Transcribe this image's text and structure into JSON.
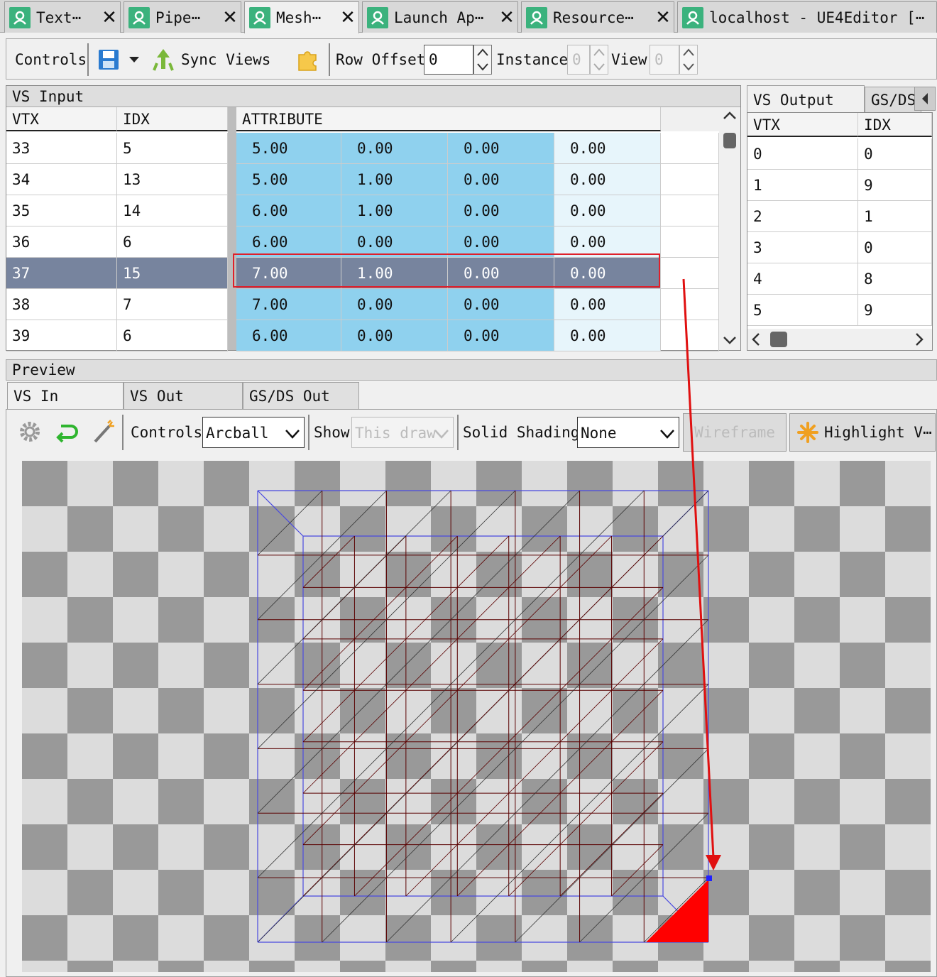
{
  "tabs": [
    {
      "label": "Text⋯"
    },
    {
      "label": "Pipe⋯"
    },
    {
      "label": "Mesh⋯"
    },
    {
      "label": "Launch Ap⋯"
    },
    {
      "label": "Resource⋯"
    },
    {
      "label": "localhost - UE4Editor [⋯"
    }
  ],
  "toolbar": {
    "controls_label": "Controls",
    "sync_views_label": "Sync Views",
    "row_offset_label": "Row Offset",
    "row_offset_value": "0",
    "instance_label": "Instance",
    "instance_value": "0",
    "view_label": "View",
    "view_value": "0"
  },
  "vs_input": {
    "title": "VS Input",
    "columns": [
      "VTX",
      "IDX",
      "ATTRIBUTE"
    ],
    "rows": [
      {
        "vtx": "33",
        "idx": "5",
        "attr": [
          "5.00",
          "0.00",
          "0.00",
          "0.00"
        ]
      },
      {
        "vtx": "34",
        "idx": "13",
        "attr": [
          "5.00",
          "1.00",
          "0.00",
          "0.00"
        ]
      },
      {
        "vtx": "35",
        "idx": "14",
        "attr": [
          "6.00",
          "1.00",
          "0.00",
          "0.00"
        ]
      },
      {
        "vtx": "36",
        "idx": "6",
        "attr": [
          "6.00",
          "0.00",
          "0.00",
          "0.00"
        ]
      },
      {
        "vtx": "37",
        "idx": "15",
        "attr": [
          "7.00",
          "1.00",
          "0.00",
          "0.00"
        ]
      },
      {
        "vtx": "38",
        "idx": "7",
        "attr": [
          "7.00",
          "0.00",
          "0.00",
          "0.00"
        ]
      },
      {
        "vtx": "39",
        "idx": "6",
        "attr": [
          "6.00",
          "0.00",
          "0.00",
          "0.00"
        ]
      }
    ],
    "selected_row": 4
  },
  "vs_output": {
    "tabs": [
      "VS Output",
      "GS/DS"
    ],
    "columns": [
      "VTX",
      "IDX"
    ],
    "rows": [
      {
        "vtx": "0",
        "idx": "0"
      },
      {
        "vtx": "1",
        "idx": "9"
      },
      {
        "vtx": "2",
        "idx": "1"
      },
      {
        "vtx": "3",
        "idx": "0"
      },
      {
        "vtx": "4",
        "idx": "8"
      },
      {
        "vtx": "5",
        "idx": "9"
      }
    ]
  },
  "preview": {
    "title": "Preview",
    "tabs": [
      "VS In",
      "VS Out",
      "GS/DS Out"
    ],
    "controls_label": "Controls",
    "controls_value": "Arcball",
    "show_label": "Show",
    "show_value": "This draw",
    "solid_shading_label": "Solid Shading",
    "solid_shading_value": "None",
    "wireframe_label": "Wireframe",
    "highlight_label": "Highlight V⋯"
  },
  "colors": {
    "accent_green": "#3bb27d",
    "selection": "#77849e",
    "attribute_cell": "#8fd1ee",
    "highlight_red": "#ff0000",
    "wire_dark": "#5a0000",
    "bbox_blue": "#4a4ae0"
  }
}
